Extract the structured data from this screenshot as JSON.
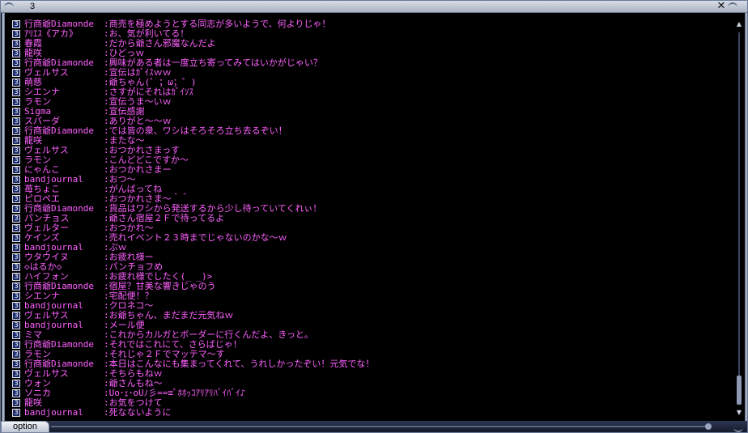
{
  "window": {
    "title": "3",
    "close_glyph": "✕",
    "option_label": "option"
  },
  "chat": {
    "channel_glyph": "3",
    "lines": [
      {
        "name": "行商爺Diamonde",
        "msg": ":商売を極めようとする同志が多いようで、何よりじゃ！"
      },
      {
        "name": "ｱﾘｴｽ《アカ》",
        "msg": ":お、気が利いてる！"
      },
      {
        "name": "春霞",
        "msg": ":だから爺さん邪魔なんだよ"
      },
      {
        "name": "龍咲",
        "msg": ":ひどっｗ"
      },
      {
        "name": "行商爺Diamonde",
        "msg": ":興味がある者は一度立ち寄ってみてはいかがじゃい？"
      },
      {
        "name": "ヴェルサス",
        "msg": ":宣伝はｶﾞｲｽｗｗ"
      },
      {
        "name": "萌慈",
        "msg": ":爺ちゃん(゜；ω；゜)"
      },
      {
        "name": "シエンナ",
        "msg": ":さすがにそれはｶﾞｲｿｽ"
      },
      {
        "name": "ラモン",
        "msg": ":宣伝うま～いｗ"
      },
      {
        "name": "Sigma",
        "msg": ":宣伝感謝"
      },
      {
        "name": "スパーダ",
        "msg": ":ありがと～～ｗ"
      },
      {
        "name": "行商爺Diamonde",
        "msg": ":では皆の衆、ワシはそろそろ立ち去るぞい！"
      },
      {
        "name": "龍咲",
        "msg": ":またな～"
      },
      {
        "name": "ヴェルサス",
        "msg": ":おつかれさまっす"
      },
      {
        "name": "ラモン",
        "msg": ":こんどどこですか～"
      },
      {
        "name": "にゃんこ",
        "msg": ":おつかれさまー"
      },
      {
        "name": "bandjournal",
        "msg": ":おつ～"
      },
      {
        "name": "苺ちょこ",
        "msg": ":がんばってね"
      },
      {
        "name": "ピロペエ",
        "msg": ":おつかれさま～＾＾"
      },
      {
        "name": "行商爺Diamonde",
        "msg": ":貨品はワシから発送するから少し待っていてくれぃ！"
      },
      {
        "name": "パンチョス",
        "msg": ":爺さん宿屋２Ｆで待ってるよ"
      },
      {
        "name": "ヴェルター",
        "msg": ":おつかれ～"
      },
      {
        "name": "ケインズ",
        "msg": ":売れイベント２３時までじゃないのかな～ｗ"
      },
      {
        "name": "bandjournal",
        "msg": ":ぷｗ"
      },
      {
        "name": "ウタウイヌ",
        "msg": ":お疲れ様ー"
      },
      {
        "name": "◇はるか◇",
        "msg": ":パンチョフめ"
      },
      {
        "name": "ハイフォン",
        "msg": ":お疲れ様でしたく(_ _)>"
      },
      {
        "name": "行商爺Diamonde",
        "msg": ":宿屋？甘美な響きじゃのう"
      },
      {
        "name": "シエンナ",
        "msg": ":宅配便！？"
      },
      {
        "name": "bandjournal",
        "msg": ":クロネコ～"
      },
      {
        "name": "ヴェルサス",
        "msg": ":お爺ちゃん、まだまだ元気ねｗ"
      },
      {
        "name": "bandjournal",
        "msg": ":メール便"
      },
      {
        "name": "ミマ",
        "msg": ":これからカルガとボーダーに行くんだよ、きっと。"
      },
      {
        "name": "行商爺Diamonde",
        "msg": ":それではこれにて、さらばじゃ！"
      },
      {
        "name": "ラモン",
        "msg": ":それじゃ２Ｆでマッテマ～す"
      },
      {
        "name": "行商爺Diamonde",
        "msg": ":本日はこんなにも集まってくれて、うれしかったぞい！元気でな！"
      },
      {
        "name": "ヴェルサス",
        "msg": ":そちらもねｗ"
      },
      {
        "name": "ウォン",
        "msg": ":爺さんもね～"
      },
      {
        "name": "ソニカ",
        "msg": ":Uo･ｪ･oUﾉ彡==≡ﾟﾎﾎｯｺｱﾘｱﾘﾊﾞｲﾊﾞｲ♪"
      },
      {
        "name": "龍咲",
        "msg": ":お気をつけて"
      },
      {
        "name": "bandjournal",
        "msg": ":死なないように"
      }
    ]
  },
  "scrollbar": {
    "up_glyph": "▲",
    "down_glyph": "▼"
  }
}
